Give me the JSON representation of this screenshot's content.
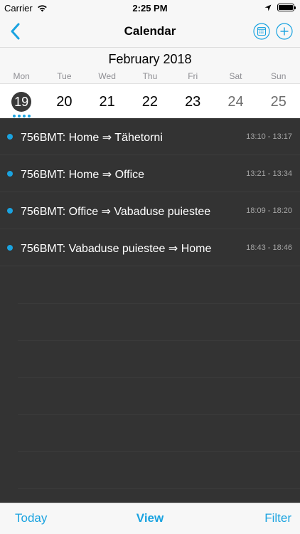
{
  "status_bar": {
    "carrier": "Carrier",
    "time": "2:25 PM"
  },
  "nav": {
    "title": "Calendar"
  },
  "calendar": {
    "month": "February 2018",
    "weekdays": [
      "Mon",
      "Tue",
      "Wed",
      "Thu",
      "Fri",
      "Sat",
      "Sun"
    ],
    "days": [
      "19",
      "20",
      "21",
      "22",
      "23",
      "24",
      "25"
    ],
    "selected_day": "19"
  },
  "events": [
    {
      "title": "756BMT: Home ⇒ Tähetorni",
      "time": "13:10 - 13:17"
    },
    {
      "title": "756BMT: Home ⇒ Office",
      "time": "13:21 - 13:34"
    },
    {
      "title": "756BMT: Office ⇒ Vabaduse puiestee",
      "time": "18:09 - 18:20"
    },
    {
      "title": "756BMT: Vabaduse puiestee ⇒ Home",
      "time": "18:43 - 18:46"
    }
  ],
  "tabs": {
    "today": "Today",
    "view": "View",
    "filter": "Filter"
  },
  "colors": {
    "accent": "#1aa3e0",
    "list_bg": "#333333",
    "selected_day_bg": "#3a3a3a"
  },
  "icons": {
    "back": "chevron-left-icon",
    "calendar": "calendar-grid-icon",
    "add": "plus-circle-icon",
    "wifi": "wifi-icon",
    "location": "location-arrow-icon",
    "battery": "battery-icon"
  }
}
